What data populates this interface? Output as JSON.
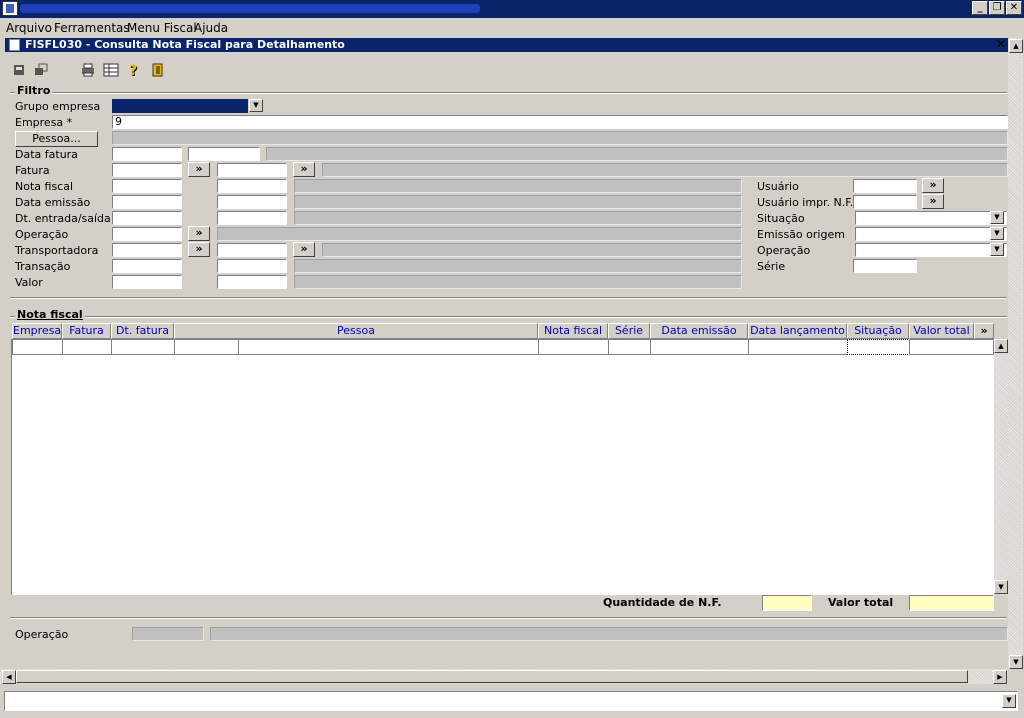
{
  "menu": [
    {
      "label": "Arquivo",
      "u": "A"
    },
    {
      "label": "Ferramentas",
      "u": "F"
    },
    {
      "label": "Menu Fiscal",
      "u": "M"
    },
    {
      "label": "Ajuda",
      "u": "A"
    }
  ],
  "window": {
    "title": "FISFL030 - Consulta Nota Fiscal para Detalhamento",
    "close": "✕"
  },
  "filter": {
    "section_label": "Filtro",
    "grupo_empresa_label": "Grupo empresa",
    "empresa_label": "Empresa *",
    "empresa_value": "9",
    "pessoa_button": "Pessoa...",
    "data_fatura_label": "Data fatura",
    "fatura_label": "Fatura",
    "nota_fiscal_label": "Nota fiscal",
    "data_emissao_label": "Data emissão",
    "dt_entrada_label": "Dt. entrada/saída",
    "operacao_label": "Operação",
    "transportadora_label": "Transportadora",
    "transacao_label": "Transação",
    "valor_label": "Valor",
    "usuario_label": "Usuário",
    "usuario_impr_label": "Usuário impr. N.F.",
    "situacao_label": "Situação",
    "emissao_origem_label": "Emissão origem",
    "operacao2_label": "Operação",
    "serie_label": "Série",
    "arrow": "»"
  },
  "grid": {
    "section_label": "Nota fiscal",
    "columns": [
      "Empresa",
      "Fatura",
      "Dt. fatura",
      "Pessoa",
      "Nota fiscal",
      "Série",
      "Data emissão",
      "Data lançamento",
      "Situação",
      "Valor total"
    ],
    "more": "»"
  },
  "totals": {
    "quantidade_label": "Quantidade de N.F.",
    "valor_total_label": "Valor total"
  },
  "footer": {
    "operacao_label": "Operação"
  }
}
